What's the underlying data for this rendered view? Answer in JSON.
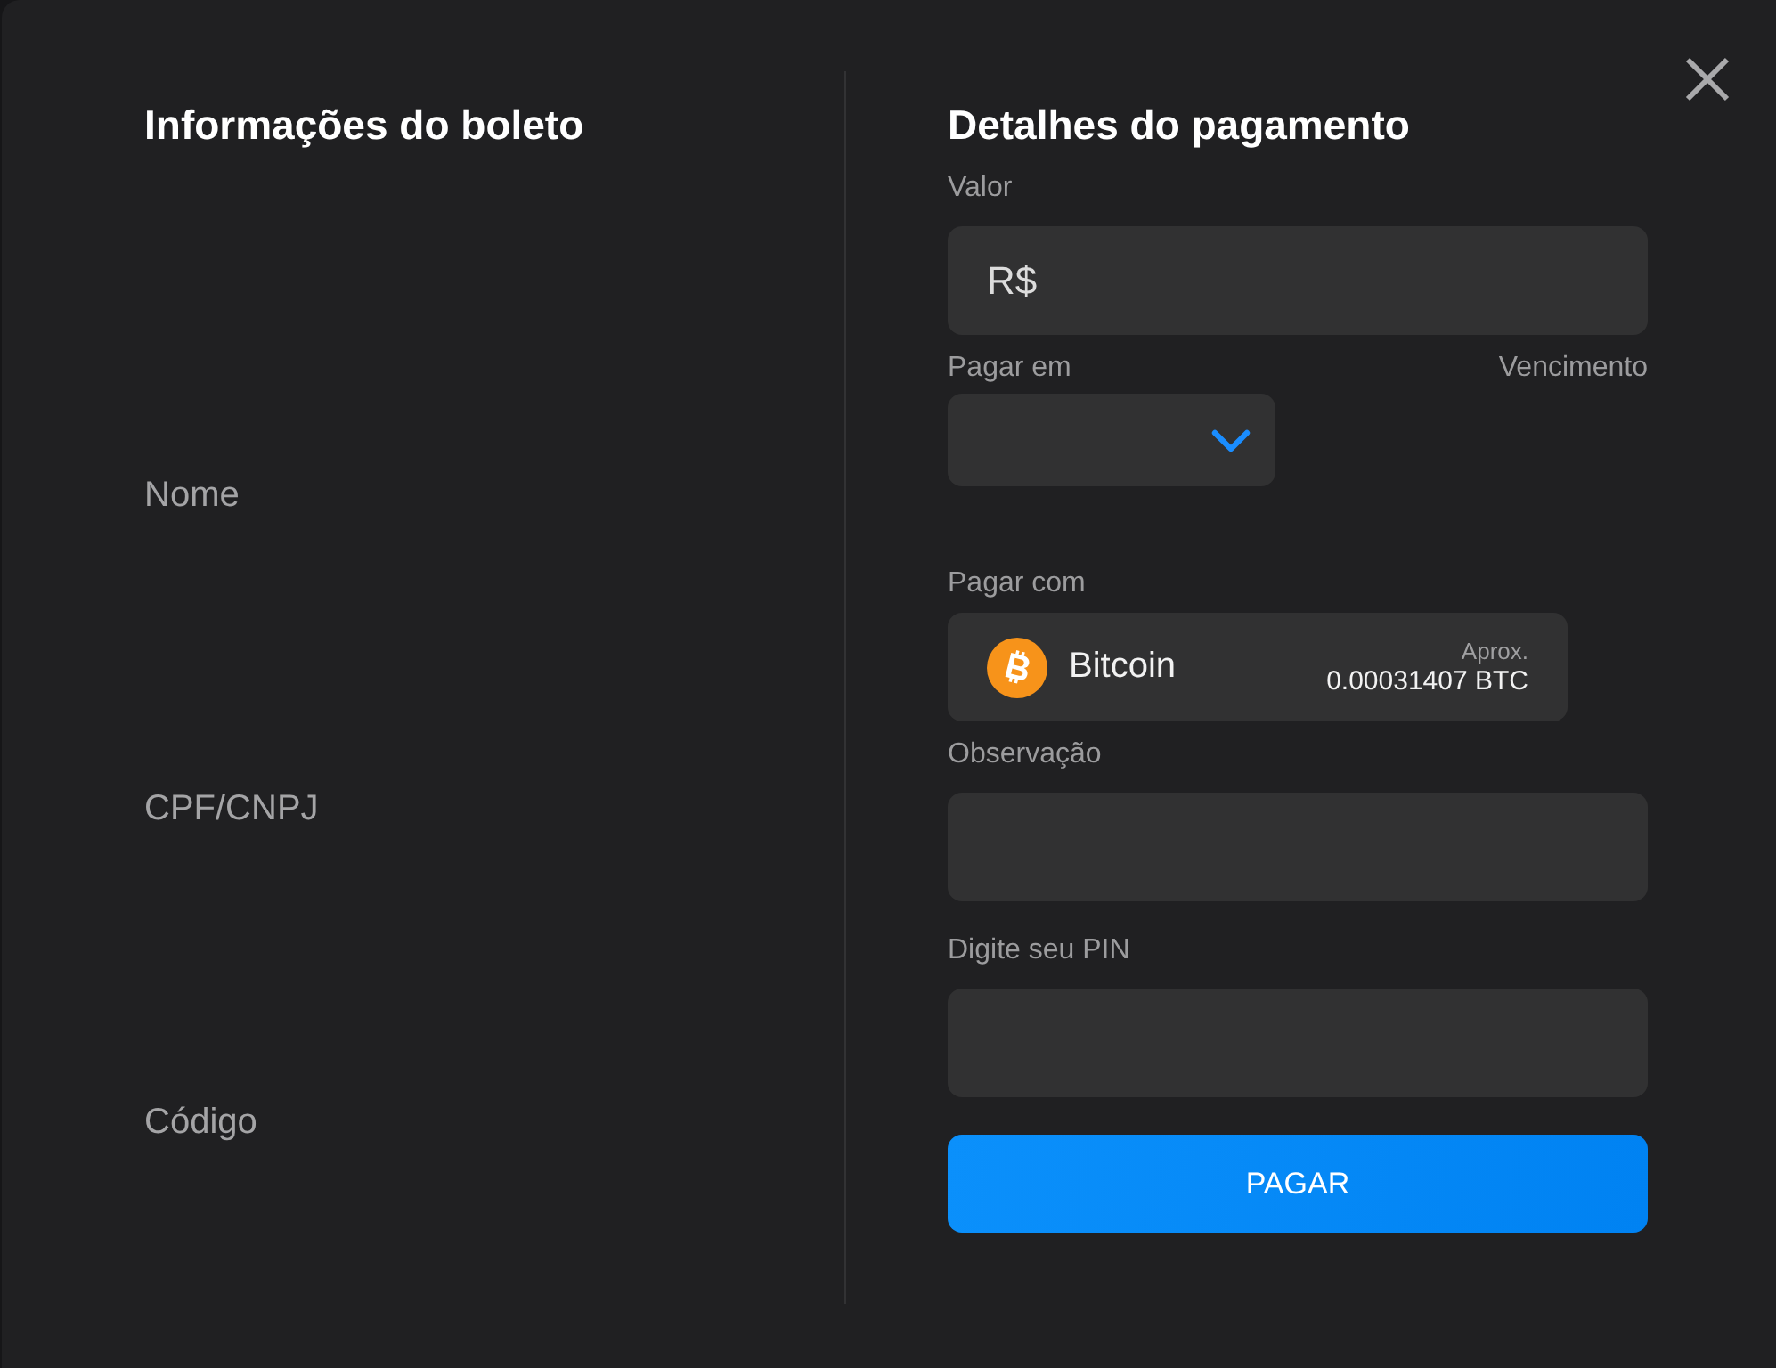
{
  "boleto_info": {
    "title": "Informações do boleto",
    "fields": [
      {
        "label": "Nome"
      },
      {
        "label": "CPF/CNPJ"
      },
      {
        "label": "Código"
      }
    ]
  },
  "payment_details": {
    "title": "Detalhes do pagamento",
    "amount": {
      "label": "Valor",
      "prefix": "R$"
    },
    "pay_on": {
      "label": "Pagar em"
    },
    "due_date": {
      "label": "Vencimento"
    },
    "pay_with": {
      "label": "Pagar com",
      "currency": "Bitcoin",
      "approx_label": "Aprox.",
      "approx_value": "0.00031407 BTC"
    },
    "note": {
      "label": "Observação"
    },
    "pin": {
      "label": "Digite seu PIN"
    },
    "submit_button": "PAGAR"
  }
}
